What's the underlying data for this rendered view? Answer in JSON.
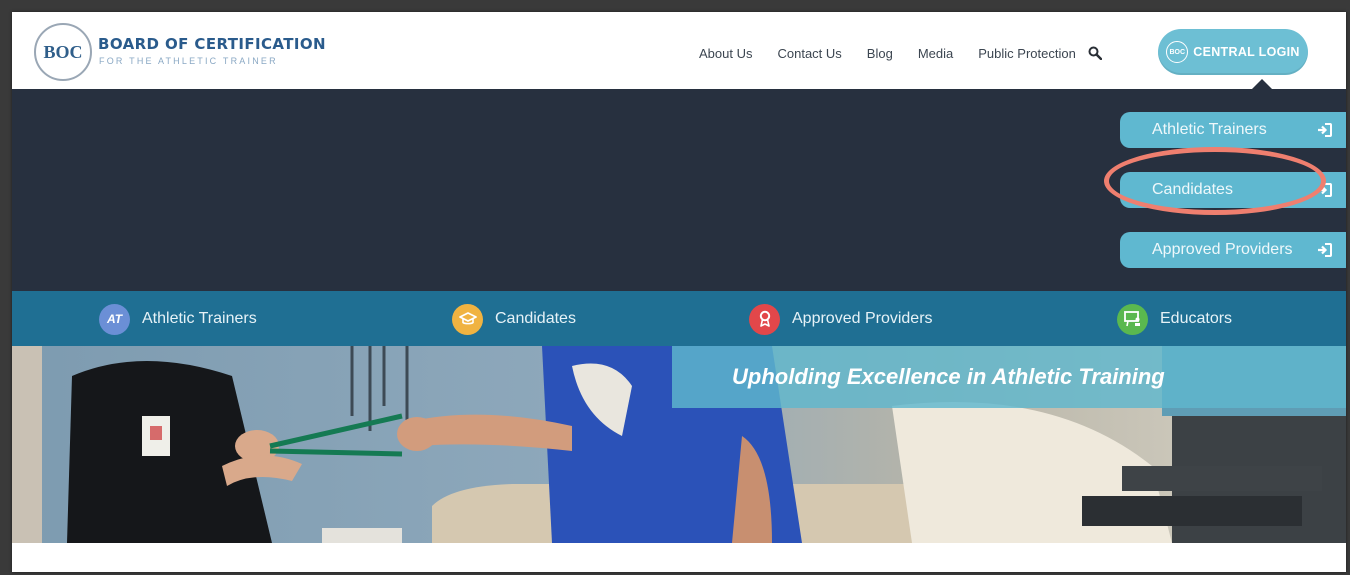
{
  "logo": {
    "mark": "BOC",
    "title": "BOARD OF CERTIFICATION",
    "subtitle": "FOR THE ATHLETIC TRAINER"
  },
  "nav": {
    "items": [
      "About Us",
      "Contact Us",
      "Blog",
      "Media",
      "Public Protection"
    ]
  },
  "central_login": {
    "mark": "BOC",
    "label": "CENTRAL LOGIN"
  },
  "login_dropdown": {
    "items": [
      "Athletic Trainers",
      "Candidates",
      "Approved Providers"
    ],
    "highlighted": "Candidates"
  },
  "categories": [
    {
      "label": "Athletic Trainers",
      "icon": "at-icon",
      "icon_text": "AT",
      "color": "#6b8fd6"
    },
    {
      "label": "Candidates",
      "icon": "graduation-cap-icon",
      "icon_text": "",
      "color": "#f0b341"
    },
    {
      "label": "Approved Providers",
      "icon": "ribbon-icon",
      "icon_text": "",
      "color": "#e2474a"
    },
    {
      "label": "Educators",
      "icon": "teacher-board-icon",
      "icon_text": "",
      "color": "#5ab84f"
    }
  ],
  "hero": {
    "tagline": "Upholding Excellence in Athletic Training"
  },
  "colors": {
    "dark_band": "#27303f",
    "category_bar": "#1f6f93",
    "accent": "#5fb8d0",
    "highlight_ring": "#ef7f6f"
  }
}
